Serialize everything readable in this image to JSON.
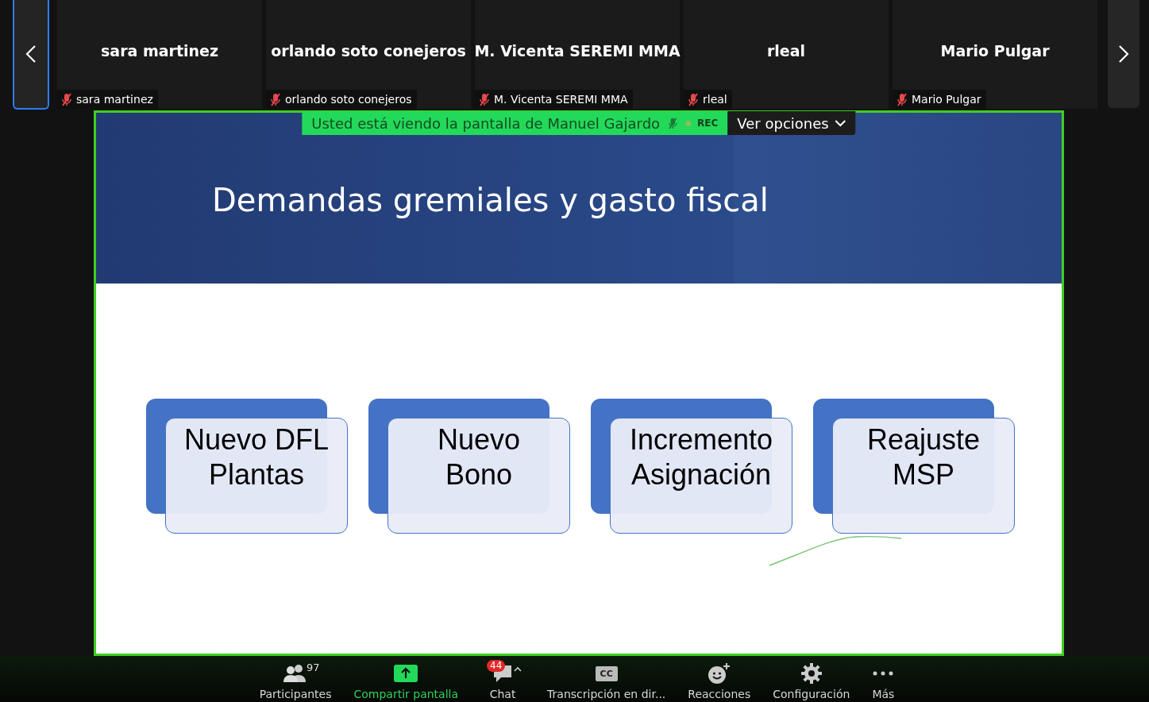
{
  "participants": [
    {
      "name": "sara martinez",
      "label": "sara martinez",
      "muted": true
    },
    {
      "name": "orlando soto conejeros",
      "label": "orlando soto conejeros",
      "muted": true
    },
    {
      "name": "M. Vicenta SEREMI MMA",
      "label": "M. Vicenta SEREMI MMA",
      "muted": true
    },
    {
      "name": "rleal",
      "label": "rleal",
      "muted": true
    },
    {
      "name": "Mario Pulgar",
      "label": "Mario Pulgar",
      "muted": true
    }
  ],
  "share_banner": {
    "text": "Usted está viendo la pantalla de Manuel Gajardo",
    "presenter_muted": true,
    "recording": true,
    "rec_label": "REC",
    "options": "Ver opciones"
  },
  "slide": {
    "title": "Demandas gremiales y gasto fiscal",
    "cards": [
      {
        "text": "Nuevo DFL\nPlantas"
      },
      {
        "text": "Nuevo\nBono"
      },
      {
        "text": "Incremento\nAsignación"
      },
      {
        "text": "Reajuste\nMSP"
      }
    ]
  },
  "toolbar": [
    {
      "kind": "participants",
      "label": "Participantes",
      "count": "97"
    },
    {
      "kind": "share",
      "label": "Compartir pantalla"
    },
    {
      "kind": "chat",
      "label": "Chat",
      "badge": "44"
    },
    {
      "kind": "captions",
      "label": "Transcripción en dir...",
      "icon_text": "CC"
    },
    {
      "kind": "reactions",
      "label": "Reacciones"
    },
    {
      "kind": "settings",
      "label": "Configuración"
    },
    {
      "kind": "more",
      "label": "Más"
    }
  ]
}
